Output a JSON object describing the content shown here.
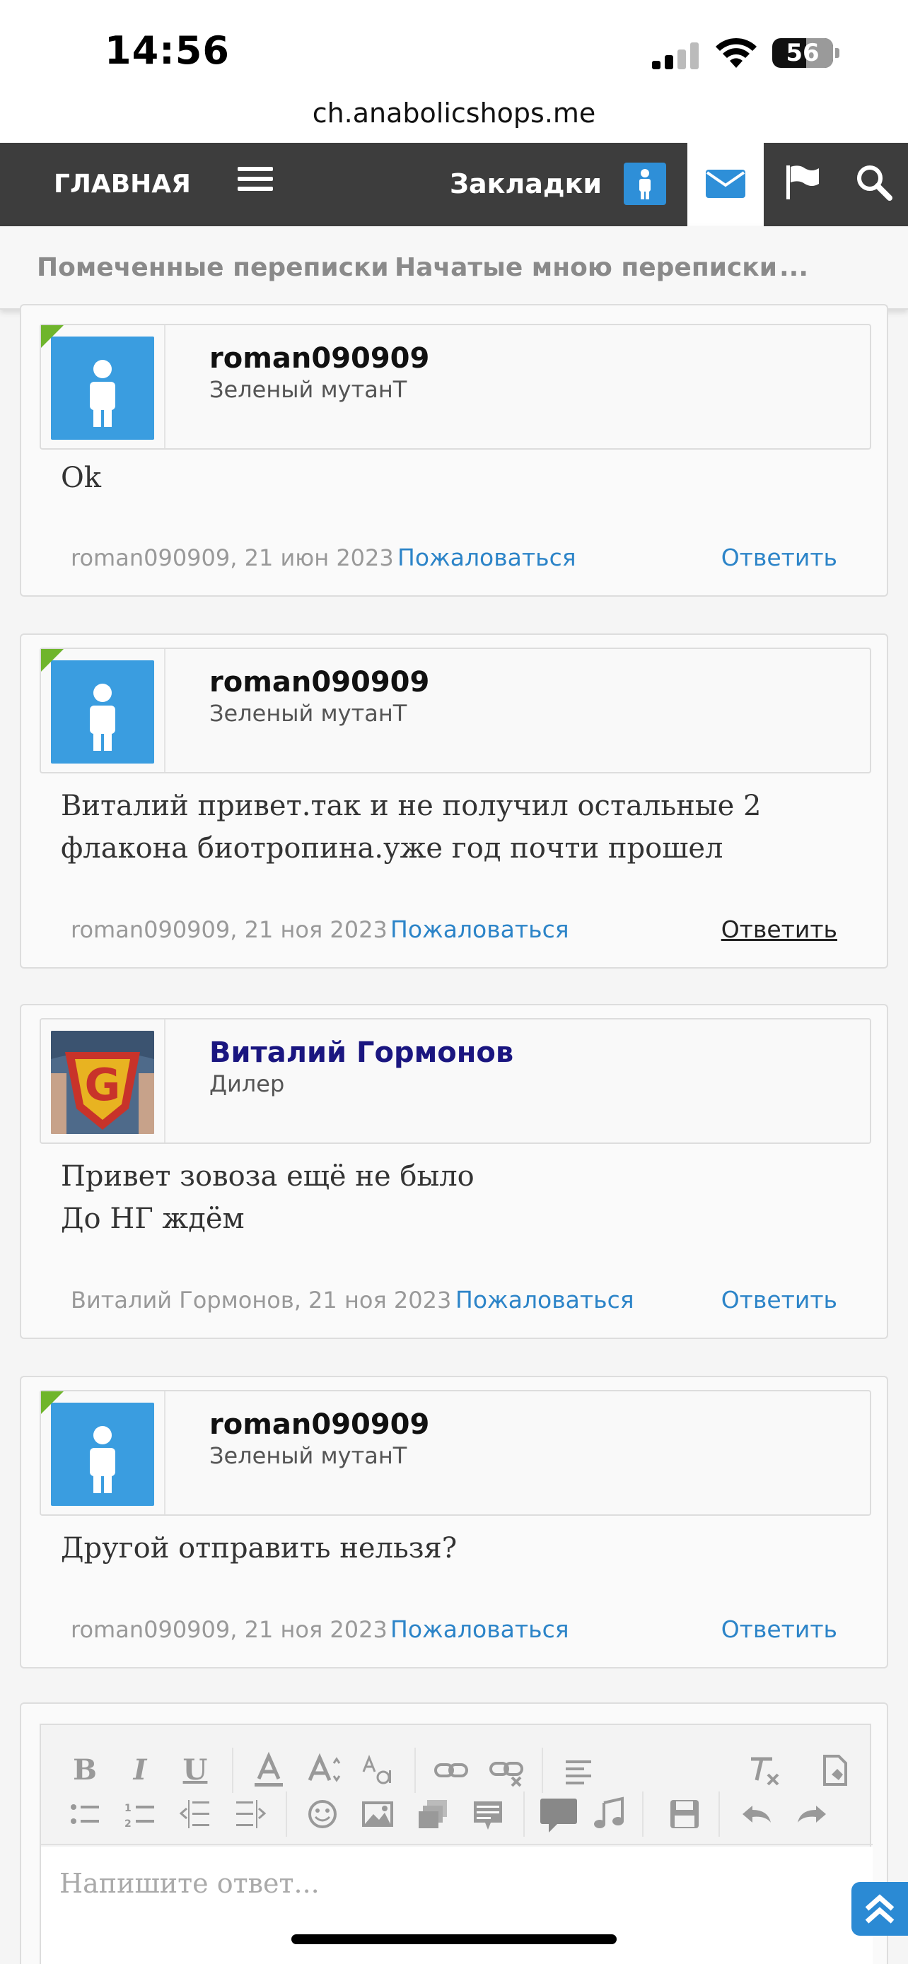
{
  "status_bar": {
    "time": "14:56",
    "battery": "56",
    "battery_level": 0.56
  },
  "browser": {
    "url": "ch.anabolicshops.me"
  },
  "nav": {
    "home": "ГЛАВНАЯ",
    "bookmarks": "Закладки"
  },
  "subnav": {
    "items": [
      "Помеченные переписки",
      "Начатые мною переписки",
      "..."
    ]
  },
  "messages": [
    {
      "username": "roman090909",
      "user_title": "Зеленый мутанТ",
      "body": "Ok",
      "meta": "roman090909, 21 июн 2023",
      "report": "Пожаловаться",
      "reply": "Ответить"
    },
    {
      "username": "roman090909",
      "user_title": "Зеленый мутанТ",
      "body": "Виталий привет.так и не получил остальные 2 флакона биотропина.уже год почти прошел",
      "meta": "roman090909, 21 ноя 2023",
      "report": "Пожаловаться",
      "reply": "Ответить"
    },
    {
      "username": "Виталий Гормонов",
      "user_title": "Дилер",
      "body": "Привет зовоза ещё не было\nДо НГ ждём",
      "meta": "Виталий Гормонов, 21 ноя 2023",
      "report": "Пожаловаться",
      "reply": "Ответить"
    },
    {
      "username": "roman090909",
      "user_title": "Зеленый мутанТ",
      "body": "Другой отправить нельзя?",
      "meta": "roman090909, 21 ноя 2023",
      "report": "Пожаловаться",
      "reply": "Ответить"
    }
  ],
  "editor": {
    "placeholder": "Напишите ответ...",
    "toolbar_row1": [
      "B",
      "I",
      "U"
    ]
  },
  "colors": {
    "nav_bg": "#3d3d3d",
    "accent": "#2c84c8",
    "online": "#6fb52c",
    "dealer_name": "#1a1680"
  }
}
